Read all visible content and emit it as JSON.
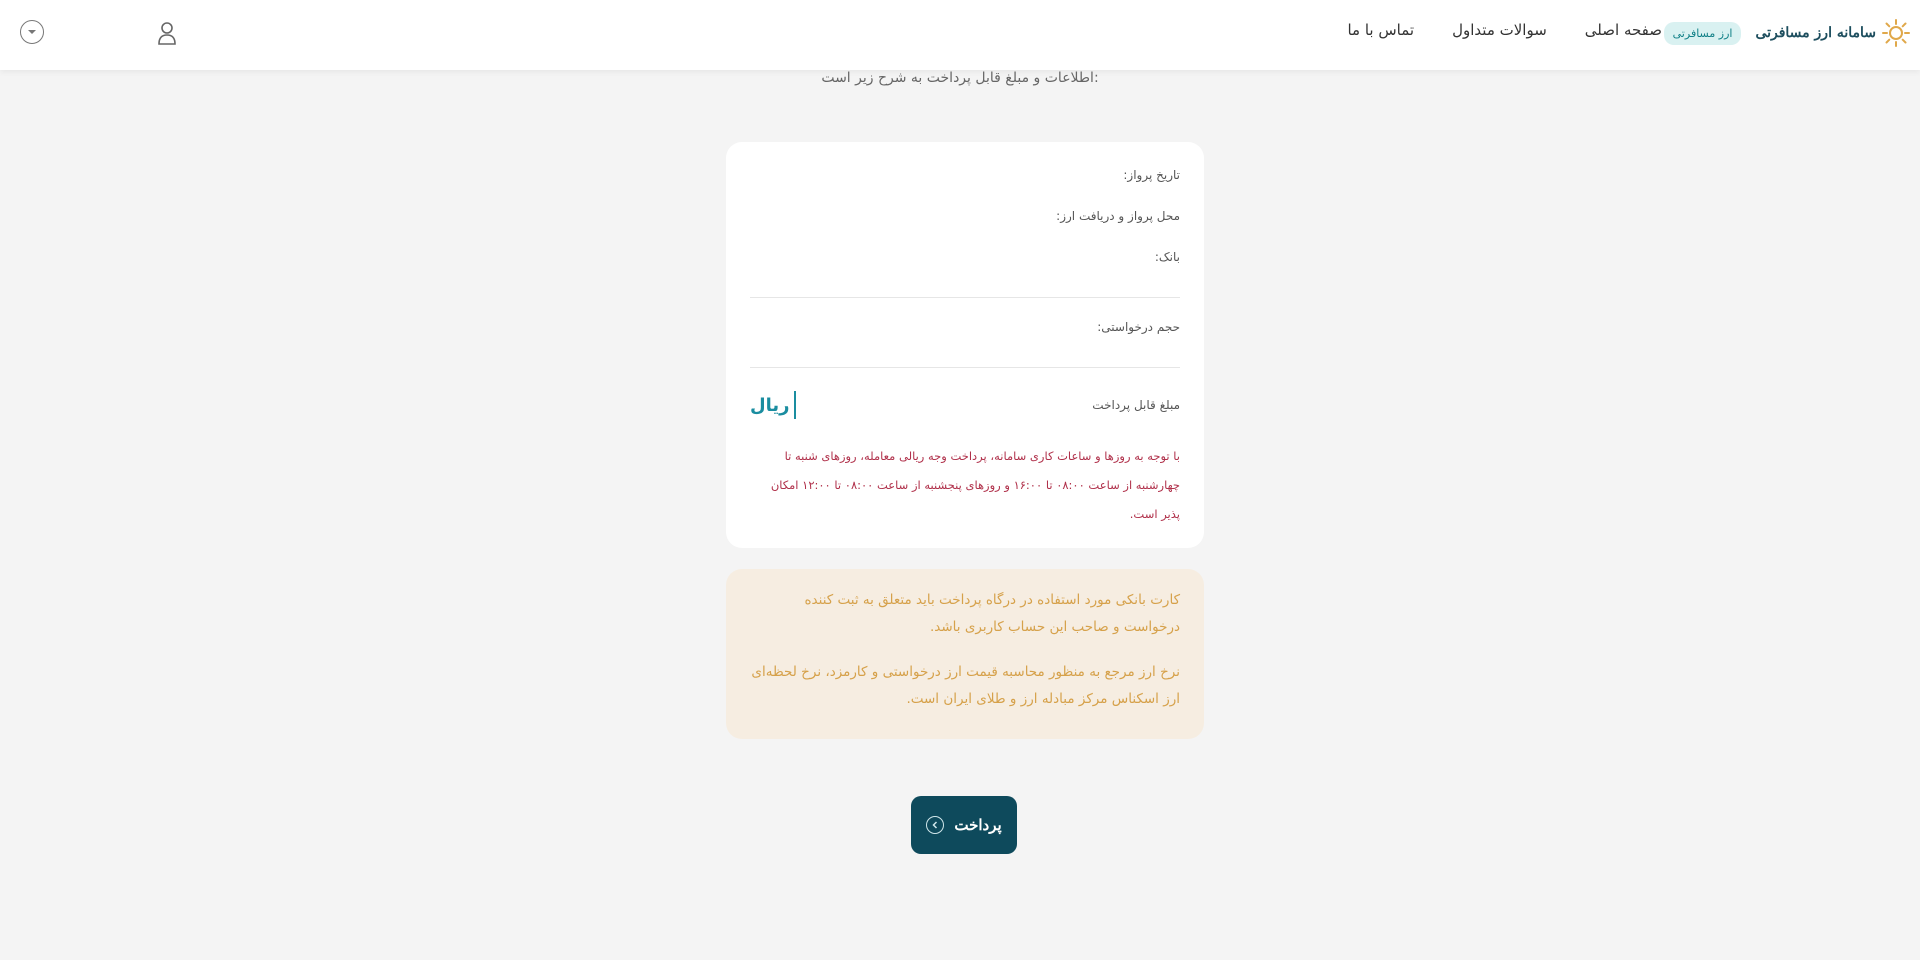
{
  "header": {
    "brand_name": "سامانه ارز مسافرتی",
    "brand_badge": "ارز مسافرتی",
    "nav": {
      "home": "صفحه اصلی",
      "faq": "سوالات متداول",
      "contact": "تماس با ما"
    },
    "icons": {
      "user": "user-icon",
      "language": "chevron-down-circle-icon"
    }
  },
  "intro": {
    "text": "اطلاعات و مبلغ قابل پرداخت به شرح زیر است:"
  },
  "details": {
    "flight_date_label": "تاریخ پرواز:",
    "flight_location_label": "محل پرواز و دریافت ارز:",
    "bank_label": "بانک:",
    "request_volume_label": "حجم درخواستی:",
    "payable_amount_label": "مبلغ قابل پرداخت",
    "payable_amount_unit": "ریال",
    "working_hours_notice": "با توجه به روزها و ساعات کاری سامانه، پرداخت وجه ریالی معامله، روزهای شنبه تا چهارشنبه از ساعت ۰۸:۰۰ تا ۱۶:۰۰ و روزهای پنجشنبه از ساعت ۰۸:۰۰ تا ۱۲:۰۰ امکان پذیر است."
  },
  "notice": {
    "card_owner": "کارت بانکی مورد استفاده در درگاه پرداخت باید متعلق به ثبت کننده درخواست و صاحب این حساب کاربری باشد.",
    "rate_reference": "نرخ ارز مرجع به منظور محاسبه قیمت ارز درخواستی و کارمزد، نرخ لحظه‌ای ارز اسکناس مرکز مبادله ارز و طلای ایران است."
  },
  "pay_button": {
    "label": "پرداخت",
    "icon": "arrow-circle-icon"
  },
  "colors": {
    "primary": "#0e4a5c",
    "accent": "#1a8da0",
    "warning_text": "#b0304a",
    "notice_bg": "#f6ede1",
    "notice_text": "#d6a14a",
    "page_bg": "#f4f4f4"
  }
}
